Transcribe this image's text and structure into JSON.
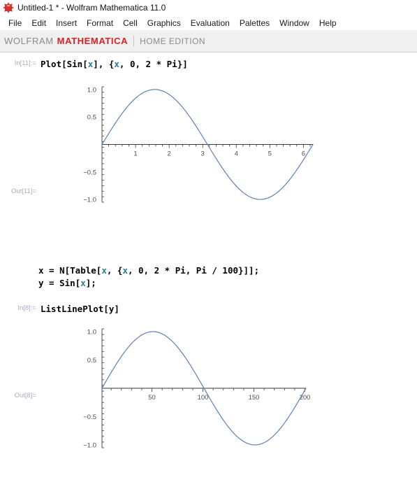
{
  "window": {
    "title": "Untitled-1 * - Wolfram Mathematica 11.0",
    "icon": "wolfram-spikey-icon"
  },
  "menubar": {
    "items": [
      {
        "label": "File"
      },
      {
        "label": "Edit"
      },
      {
        "label": "Insert"
      },
      {
        "label": "Format"
      },
      {
        "label": "Cell"
      },
      {
        "label": "Graphics"
      },
      {
        "label": "Evaluation"
      },
      {
        "label": "Palettes"
      },
      {
        "label": "Window"
      },
      {
        "label": "Help"
      }
    ]
  },
  "banner": {
    "wolfram": "WOLFRAM",
    "mathematica": "MATHEMATICA",
    "edition": "HOME EDITION",
    "accent_color": "#dd2222",
    "muted_color": "#8a8a8a",
    "background": "#f0f0f0"
  },
  "notebook": {
    "cells": [
      {
        "type": "input",
        "label": "In[11]:=",
        "code_parts": [
          {
            "text": "Plot[Sin[",
            "sym": false
          },
          {
            "text": "x",
            "sym": true
          },
          {
            "text": "], {",
            "sym": false
          },
          {
            "text": "x",
            "sym": true
          },
          {
            "text": ", 0, 2 * Pi}]",
            "sym": false
          }
        ]
      },
      {
        "type": "output",
        "label": "Out[11]="
      },
      {
        "type": "input",
        "label": "",
        "code_lines": [
          [
            {
              "text": "x",
              "sym": false
            },
            {
              "text": " = N[Table[",
              "sym": false
            },
            {
              "text": "x",
              "sym": true
            },
            {
              "text": ", {",
              "sym": false
            },
            {
              "text": "x",
              "sym": true
            },
            {
              "text": ", 0, 2 * Pi, Pi / 100}]];",
              "sym": false
            }
          ],
          [
            {
              "text": "y",
              "sym": false
            },
            {
              "text": " = Sin[",
              "sym": false
            },
            {
              "text": "x",
              "sym": true
            },
            {
              "text": "];",
              "sym": false
            }
          ]
        ]
      },
      {
        "type": "input",
        "label": "In[8]:=",
        "code_parts": [
          {
            "text": "ListLinePlot[",
            "sym": false
          },
          {
            "text": "y",
            "sym": false
          },
          {
            "text": "]",
            "sym": false
          }
        ]
      },
      {
        "type": "output",
        "label": "Out[8]="
      }
    ]
  },
  "chart_data": [
    {
      "id": "plot-sin",
      "type": "line",
      "title": "",
      "xlabel": "",
      "ylabel": "",
      "expression": "Sin[x]",
      "xlim": [
        0,
        6.283185
      ],
      "ylim": [
        -1.05,
        1.05
      ],
      "x_ticks": [
        1,
        2,
        3,
        4,
        5,
        6
      ],
      "x_tick_labels": [
        "1",
        "2",
        "3",
        "4",
        "5",
        "6"
      ],
      "x_minor_count": 4,
      "y_ticks": [
        -1.0,
        -0.5,
        0.5,
        1.0
      ],
      "y_tick_labels": [
        "-1.0",
        "-0.5",
        "0.5",
        "1.0"
      ],
      "y_minor_count": 4,
      "grid": false,
      "legend": false,
      "line_color": "#5e81b5",
      "line_width": 1.2,
      "samples": 201
    },
    {
      "id": "plot-listline",
      "type": "line",
      "title": "",
      "xlabel": "",
      "ylabel": "",
      "expression": "Sin[x] sampled at 201 points",
      "xlim": [
        1,
        201
      ],
      "ylim": [
        -1.05,
        1.05
      ],
      "x_ticks": [
        50,
        100,
        150,
        200
      ],
      "x_tick_labels": [
        "50",
        "100",
        "150",
        "200"
      ],
      "x_minor_count": 4,
      "y_ticks": [
        -1.0,
        -0.5,
        0.5,
        1.0
      ],
      "y_tick_labels": [
        "-1.0",
        "-0.5",
        "0.5",
        "1.0"
      ],
      "y_minor_count": 4,
      "grid": false,
      "legend": false,
      "line_color": "#5e81b5",
      "line_width": 1.2,
      "samples": 201
    }
  ]
}
